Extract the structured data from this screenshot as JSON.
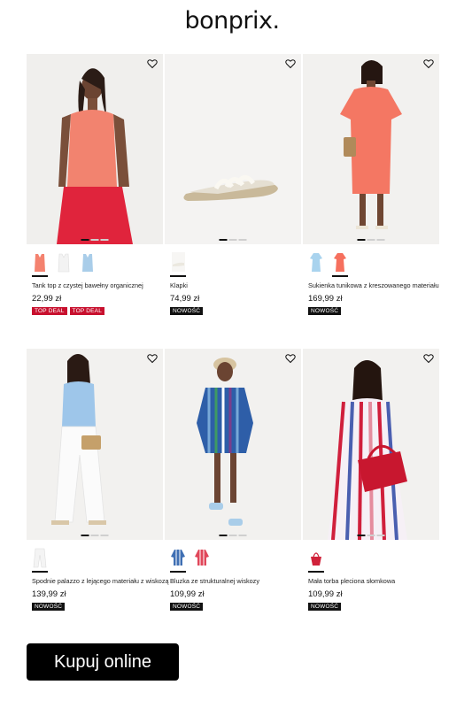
{
  "brand": "bonprix.",
  "products": [
    {
      "name": "Tank top z czystej bawełny organicznej",
      "price": "22,99 zł",
      "badges": [
        {
          "text": "TOP DEAL",
          "style": "red"
        },
        {
          "text": "TOP DEAL",
          "style": "red"
        }
      ],
      "swatch_colors": [
        "#f4826f",
        "#f3f3f3",
        "#a9cde9"
      ]
    },
    {
      "name": "Klapki",
      "price": "74,99 zł",
      "badges": [
        {
          "text": "NOWOŚĆ",
          "style": "black"
        }
      ],
      "swatch_colors": [
        "#ebe8df"
      ]
    },
    {
      "name": "Sukienka tunikowa z kreszowanego materiału",
      "price": "169,99 zł",
      "badges": [
        {
          "text": "NOWOŚĆ",
          "style": "black"
        }
      ],
      "swatch_colors": [
        "#a9d3ee",
        "#f6705e"
      ]
    },
    {
      "name": "Spodnie palazzo z lejącego materiału z wiskozą",
      "price": "139,99 zł",
      "badges": [
        {
          "text": "NOWOŚĆ",
          "style": "black"
        }
      ],
      "swatch_colors": [
        "#f4f4f4"
      ]
    },
    {
      "name": "Bluzka ze strukturalnej wiskozy",
      "price": "109,99 zł",
      "badges": [
        {
          "text": "NOWOŚĆ",
          "style": "black"
        }
      ],
      "swatch_colors": [
        "#3f6fb3",
        "#e0475a"
      ]
    },
    {
      "name": "Mała torba pleciona słomkowa",
      "price": "109,99 zł",
      "badges": [
        {
          "text": "NOWOŚĆ",
          "style": "black"
        }
      ],
      "swatch_colors": [
        "#d0223a"
      ]
    }
  ],
  "cta": {
    "label": "Kupuj online"
  },
  "icons": {
    "favorite": "heart-icon"
  }
}
